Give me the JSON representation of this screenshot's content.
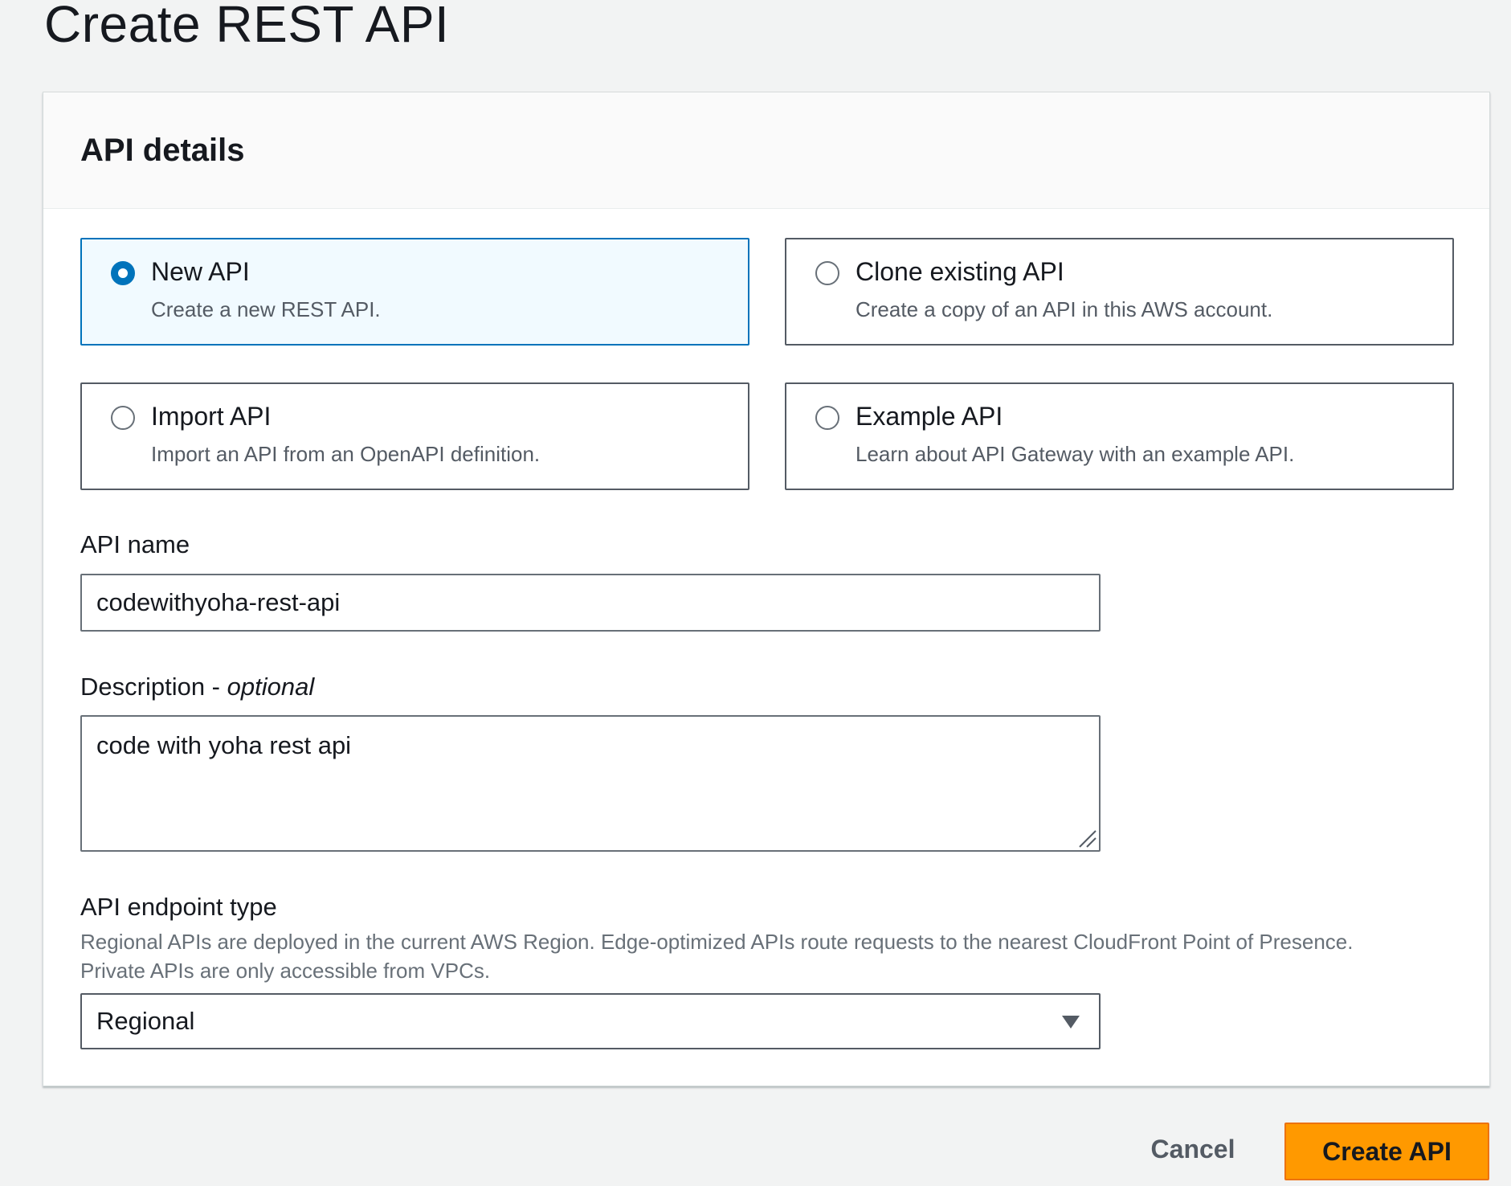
{
  "page": {
    "title": "Create REST API"
  },
  "panel": {
    "header": "API details"
  },
  "options": [
    {
      "title": "New API",
      "description": "Create a new REST API.",
      "selected": true
    },
    {
      "title": "Clone existing API",
      "description": "Create a copy of an API in this AWS account.",
      "selected": false
    },
    {
      "title": "Import API",
      "description": "Import an API from an OpenAPI definition.",
      "selected": false
    },
    {
      "title": "Example API",
      "description": "Learn about API Gateway with an example API.",
      "selected": false
    }
  ],
  "api_name": {
    "label": "API name",
    "value": "codewithyoha-rest-api"
  },
  "description": {
    "label": "Description - ",
    "label_optional": "optional",
    "value": "code with yoha rest api"
  },
  "endpoint_type": {
    "label": "API endpoint type",
    "hint_line1": "Regional APIs are deployed in the current AWS Region. Edge-optimized APIs route requests to the nearest CloudFront Point of Presence.",
    "hint_line2": "Private APIs are only accessible from VPCs.",
    "selected": "Regional"
  },
  "actions": {
    "cancel": "Cancel",
    "create": "Create API"
  },
  "colors": {
    "accent": "#0073bb",
    "primary_button": "#ff9900",
    "background": "#f2f3f3"
  }
}
